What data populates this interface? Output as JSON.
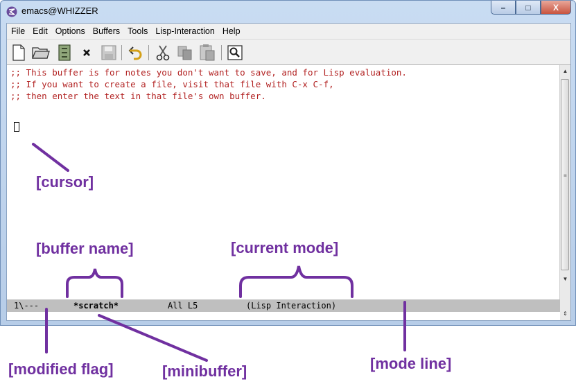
{
  "window": {
    "title": "emacs@WHIZZER",
    "controls": {
      "minimize": "–",
      "maximize": "□",
      "close": "X"
    }
  },
  "menubar": {
    "items": [
      {
        "label": "File"
      },
      {
        "label": "Edit"
      },
      {
        "label": "Options"
      },
      {
        "label": "Buffers"
      },
      {
        "label": "Tools"
      },
      {
        "label": "Lisp-Interaction"
      },
      {
        "label": "Help"
      }
    ]
  },
  "toolbar": {
    "buttons": [
      "new-file-icon",
      "open-folder-icon",
      "dired-icon",
      "close-buffer-icon",
      "save-icon",
      "undo-icon",
      "cut-icon",
      "copy-icon",
      "paste-icon",
      "search-icon"
    ]
  },
  "editor": {
    "lines": [
      ";; This buffer is for notes you don't want to save, and for Lisp evaluation.",
      ";; If you want to create a file, visit that file with C-x C-f,",
      ";; then enter the text in that file's own buffer."
    ],
    "comment_color": "#b22222"
  },
  "modeline": {
    "flags": "1\\---",
    "buffer_name": "*scratch*",
    "position": "All L5",
    "mode": "(Lisp Interaction)"
  },
  "annotations": {
    "cursor": "[cursor]",
    "buffer_name": "[buffer name]",
    "current_mode": "[current mode]",
    "modified_flag": "[modified flag]",
    "minibuffer": "[minibuffer]",
    "mode_line": "[mode line]",
    "color": "#7030a0"
  }
}
